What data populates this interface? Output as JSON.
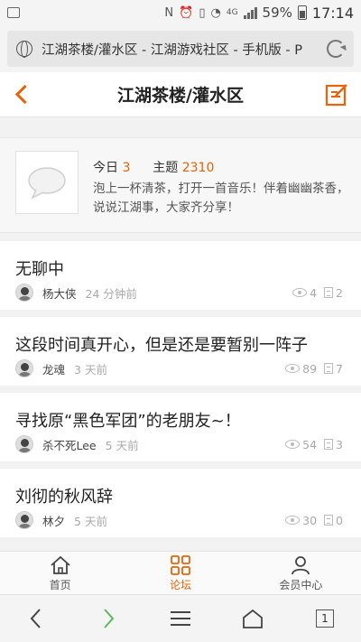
{
  "status_bar": {
    "network": "4G",
    "battery_percent": "59%",
    "time": "17:14"
  },
  "browser": {
    "url": "江湖茶楼/灌水区 - 江湖游戏社区 - 手机版 - P",
    "tab_count": "1"
  },
  "header": {
    "title": "江湖茶楼/灌水区"
  },
  "forum": {
    "today_label": "今日",
    "today_count": "3",
    "topics_label": "主题",
    "topics_count": "2310",
    "description": "泡上一杯清茶，打开一首音乐！伴着幽幽茶香，说说江湖事，大家齐分享！"
  },
  "threads": [
    {
      "title": "无聊中",
      "author": "杨大侠",
      "time": "24 分钟前",
      "views": "4",
      "replies": "2"
    },
    {
      "title": "这段时间真开心，但是还是要暂别一阵子",
      "author": "龙魂",
      "time": "3 天前",
      "views": "89",
      "replies": "7"
    },
    {
      "title": "寻找原“黑色军团”的老朋友~！",
      "author": "杀不死Lee",
      "time": "5 天前",
      "views": "54",
      "replies": "3"
    },
    {
      "title": "刘彻的秋风辞",
      "author": "林夕",
      "time": "5 天前",
      "views": "30",
      "replies": "0"
    }
  ],
  "bottom_nav": {
    "items": [
      {
        "label": "首页",
        "icon": "home-icon"
      },
      {
        "label": "论坛",
        "icon": "grid-icon"
      },
      {
        "label": "会员中心",
        "icon": "user-icon"
      }
    ],
    "active_index": 1
  },
  "colors": {
    "accent": "#e8630a"
  }
}
